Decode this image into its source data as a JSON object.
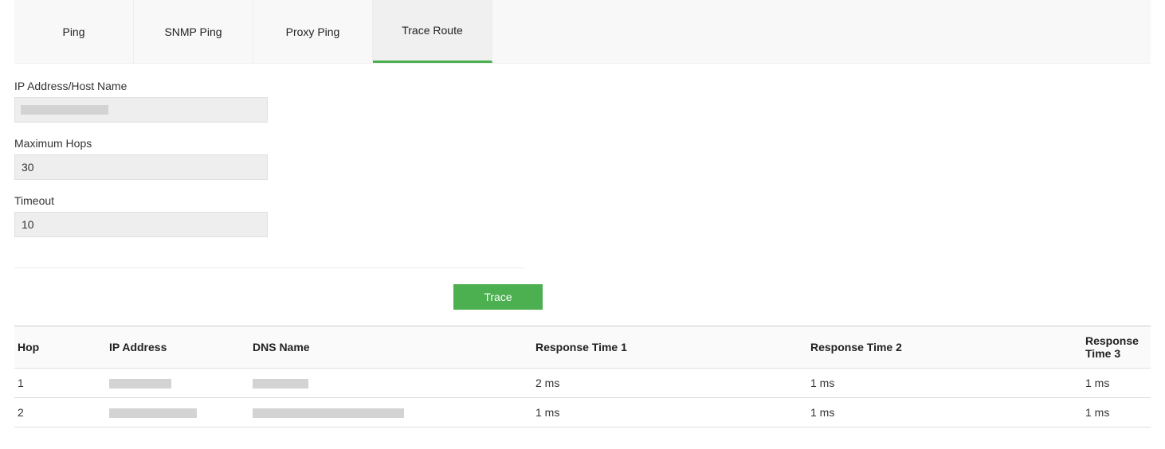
{
  "tabs": [
    {
      "label": "Ping"
    },
    {
      "label": "SNMP Ping"
    },
    {
      "label": "Proxy Ping"
    },
    {
      "label": "Trace Route"
    }
  ],
  "form": {
    "ip_label": "IP Address/Host Name",
    "ip_value": "",
    "hops_label": "Maximum Hops",
    "hops_value": "30",
    "timeout_label": "Timeout",
    "timeout_value": "10",
    "trace_button": "Trace"
  },
  "table": {
    "headers": {
      "hop": "Hop",
      "ip": "IP Address",
      "dns": "DNS Name",
      "rt1": "Response Time 1",
      "rt2": "Response Time 2",
      "rt3": "Response Time 3"
    },
    "rows": [
      {
        "hop": "1",
        "ip": "",
        "dns": "",
        "rt1": "2 ms",
        "rt2": "1 ms",
        "rt3": "1 ms"
      },
      {
        "hop": "2",
        "ip": "",
        "dns": "",
        "rt1": "1 ms",
        "rt2": "1 ms",
        "rt3": "1 ms"
      }
    ]
  }
}
